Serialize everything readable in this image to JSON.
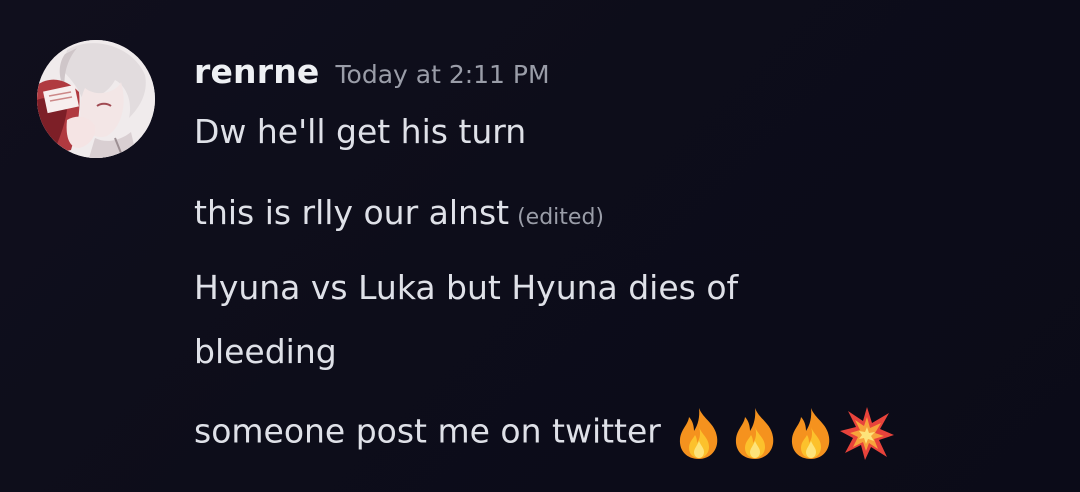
{
  "message": {
    "username": "renrne",
    "timestamp": "Today at 2:11 PM",
    "lines": [
      {
        "text": "Dw he'll get his turn"
      },
      {
        "text": "this is rlly our alnst",
        "edited_label": "(edited)"
      },
      {
        "text": "Hyuna vs Luka but Hyuna dies of"
      },
      {
        "text": "bleeding"
      },
      {
        "text": "someone post me on twitter"
      }
    ],
    "reactions_inline": [
      "fire-emoji",
      "fire-emoji",
      "fire-emoji",
      "collision-emoji"
    ]
  },
  "colors": {
    "background": "#0d0d1a",
    "username": "#eef0f4",
    "text": "#dfe1e8",
    "muted": "#9a9da8"
  }
}
